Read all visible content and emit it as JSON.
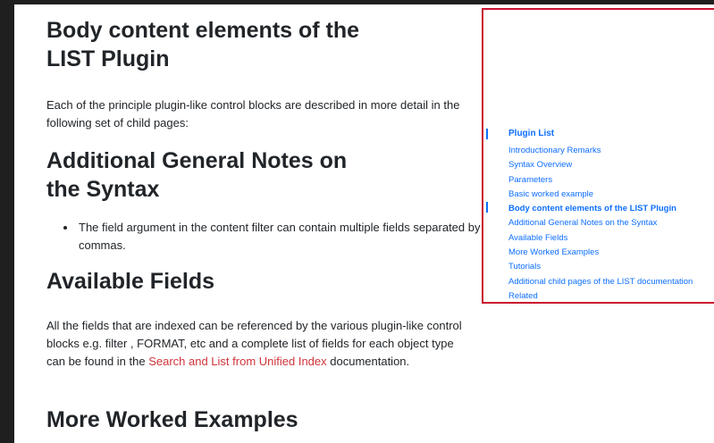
{
  "main": {
    "heading1_line1": "Body content elements of the",
    "heading1_line2": "LIST Plugin",
    "intro_paragraph": "Each of the principle plugin-like control blocks are described in more detail in the following set of child pages:",
    "heading2_line1": "Additional General Notes on",
    "heading2_line2": "the Syntax",
    "bullet_1": "The field argument in the content filter can contain multiple fields separated by commas.",
    "heading3": "Available Fields",
    "fields_paragraph_before_link": "All the fields that are indexed can be referenced by the various plugin-like control blocks e.g. filter , FORMAT, etc and a complete list of fields for each object type can be found in the ",
    "fields_link": "Search and List from Unified Index",
    "fields_paragraph_after_link": " documentation.",
    "heading4": "More Worked Examples"
  },
  "toc": {
    "heading": "Plugin List",
    "items": [
      "Introductionary Remarks",
      "Syntax Overview",
      "Parameters",
      "Basic worked example",
      "Body content elements of the LIST Plugin",
      "Additional General Notes on the Syntax",
      "Available Fields",
      "More Worked Examples",
      "Tutorials",
      "Additional child pages of the LIST documentation",
      "Related"
    ],
    "active_item": "Body content elements of the LIST Plugin"
  },
  "colors": {
    "link": "#0d6efd",
    "inline_link": "#d0343a",
    "highlight_border": "#c8102e",
    "text": "#212529"
  }
}
